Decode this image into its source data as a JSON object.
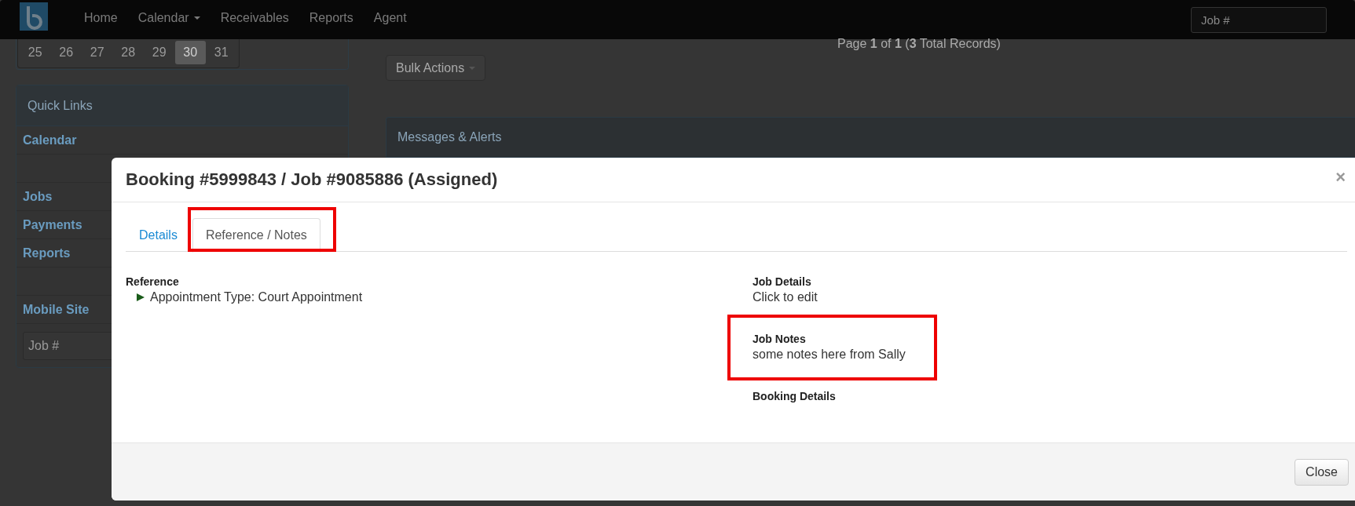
{
  "navbar": {
    "items": [
      {
        "label": "Home",
        "dropdown": false
      },
      {
        "label": "Calendar",
        "dropdown": true
      },
      {
        "label": "Receivables",
        "dropdown": false
      },
      {
        "label": "Reports",
        "dropdown": false
      },
      {
        "label": "Agent",
        "dropdown": false
      }
    ],
    "search": {
      "placeholder": "Job #"
    }
  },
  "calendar": {
    "days": [
      {
        "label": "25",
        "selected": false
      },
      {
        "label": "26",
        "selected": false
      },
      {
        "label": "27",
        "selected": false
      },
      {
        "label": "28",
        "selected": false
      },
      {
        "label": "29",
        "selected": false
      },
      {
        "label": "30",
        "selected": true
      },
      {
        "label": "31",
        "selected": false
      }
    ]
  },
  "quick_links": {
    "title": "Quick Links",
    "items": [
      {
        "kind": "link",
        "label": "Calendar"
      },
      {
        "kind": "blank"
      },
      {
        "kind": "link",
        "label": "Jobs"
      },
      {
        "kind": "link",
        "label": "Payments"
      },
      {
        "kind": "link",
        "label": "Reports"
      },
      {
        "kind": "blank"
      },
      {
        "kind": "link",
        "label": "Mobile Site"
      },
      {
        "kind": "field",
        "placeholder": "Job #"
      }
    ]
  },
  "pager": {
    "text": "Page **1** of **1** (**3** Total Records)"
  },
  "bulk_actions": {
    "label": "Bulk Actions"
  },
  "messages_panel": {
    "title": "Messages & Alerts"
  },
  "modal": {
    "title": "Booking #5999843 / Job #9085886 (Assigned)",
    "tabs": [
      {
        "label": "Details",
        "selected": false,
        "highlighted": false
      },
      {
        "label": "Reference / Notes",
        "selected": true,
        "highlighted": true
      }
    ],
    "left": [
      {
        "heading": "Reference",
        "bullets": [
          "Appointment Type: Court Appointment"
        ],
        "highlighted": false
      }
    ],
    "right": [
      {
        "heading": "Job Details",
        "text": "Click to edit",
        "highlighted": false
      },
      {
        "heading": "Job Notes",
        "text": "some notes here from Sally",
        "highlighted": true
      },
      {
        "heading": "Booking Details",
        "highlighted": false
      }
    ],
    "close_icon": "×",
    "close_button": "Close"
  }
}
